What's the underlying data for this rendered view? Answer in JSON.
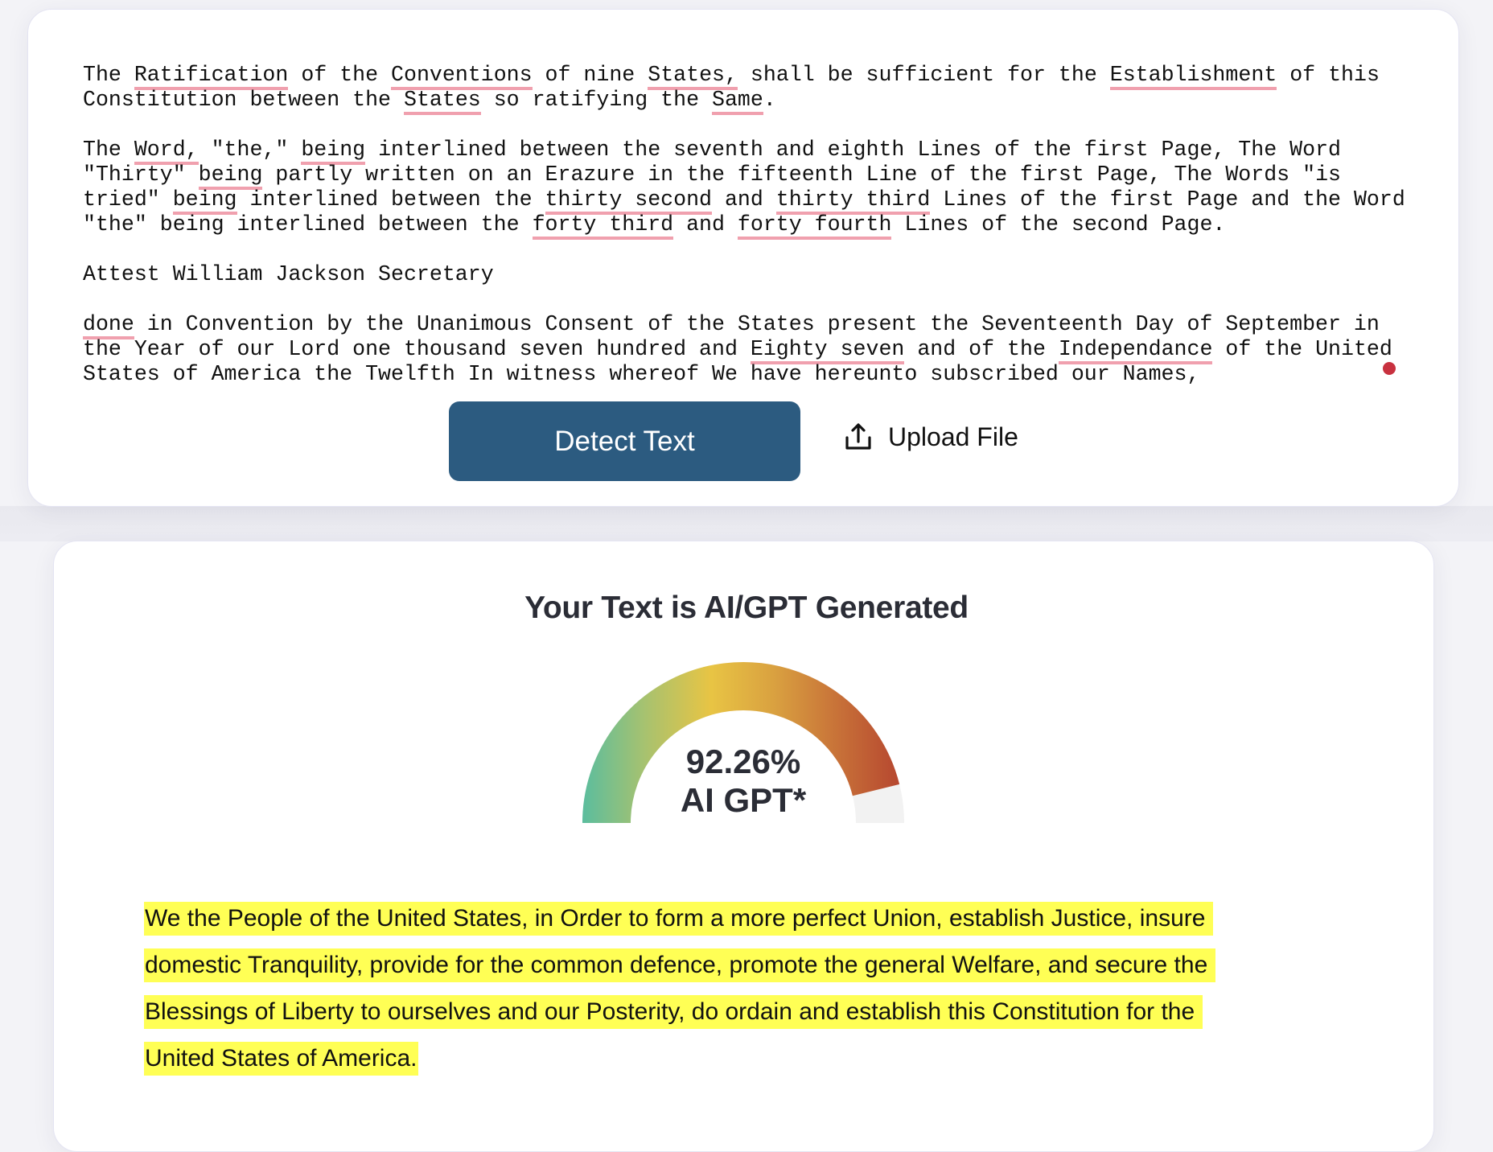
{
  "editor": {
    "lines": [
      [
        {
          "t": "The "
        },
        {
          "t": "Ratification",
          "f": true
        },
        {
          "t": " of the "
        },
        {
          "t": "Conventions",
          "f": true
        },
        {
          "t": " of nine "
        },
        {
          "t": "States,",
          "f": true
        },
        {
          "t": " shall be sufficient for the "
        },
        {
          "t": "Establishment",
          "f": true
        },
        {
          "t": " of this"
        }
      ],
      [
        {
          "t": "Constitution between the "
        },
        {
          "t": "States",
          "f": true
        },
        {
          "t": " so ratifying the "
        },
        {
          "t": "Same",
          "f": true
        },
        {
          "t": "."
        }
      ],
      [],
      [
        {
          "t": "The "
        },
        {
          "t": "Word,",
          "f": true
        },
        {
          "t": " \"the,\" "
        },
        {
          "t": "being",
          "f": true
        },
        {
          "t": " interlined between the seventh and eighth Lines of the first Page, The Word"
        }
      ],
      [
        {
          "t": "\"Thirty\" "
        },
        {
          "t": "being",
          "f": true
        },
        {
          "t": " partly written on an Erazure in the fifteenth Line of the first Page, The Words \"is"
        }
      ],
      [
        {
          "t": "tried\" "
        },
        {
          "t": "being",
          "f": true
        },
        {
          "t": " interlined between the "
        },
        {
          "t": "thirty second",
          "f": true
        },
        {
          "t": " and "
        },
        {
          "t": "thirty third",
          "f": true
        },
        {
          "t": " Lines of the first Page and the Word"
        }
      ],
      [
        {
          "t": "\"the\" being interlined between the "
        },
        {
          "t": "forty third",
          "f": true
        },
        {
          "t": " and "
        },
        {
          "t": "forty fourth",
          "f": true
        },
        {
          "t": " Lines of the second Page."
        }
      ],
      [],
      [
        {
          "t": "Attest William Jackson Secretary"
        }
      ],
      [],
      [
        {
          "t": "done",
          "f": true
        },
        {
          "t": " in Convention by the Unanimous Consent of the States present the Seventeenth Day of September in"
        }
      ],
      [
        {
          "t": "the Year of our Lord one thousand seven hundred and "
        },
        {
          "t": "Eighty seven",
          "f": true
        },
        {
          "t": " and of the "
        },
        {
          "t": "Independance",
          "f": true
        },
        {
          "t": " of the United"
        }
      ],
      [
        {
          "t": "States of America the Twelfth In witness whereof We have hereunto subscribed our Names,"
        }
      ]
    ]
  },
  "actions": {
    "detect_label": "Detect Text",
    "upload_label": "Upload File",
    "upload_icon": "upload-icon"
  },
  "result": {
    "title": "Your Text is AI/GPT Generated",
    "score_text": "92.26%",
    "score_label": "AI GPT*",
    "score_fraction": 0.9226,
    "gauge_colors": [
      "#5bbd9e",
      "#a9c26e",
      "#e8c444",
      "#d9a040",
      "#c77038",
      "#b5442f"
    ],
    "gauge_track_color": "#f2f2f2",
    "highlight_color": "#ffff55",
    "highlighted_lines": [
      "We the People of the United States, in Order to form a more perfect Union, establish Justice, insure ",
      "domestic Tranquility, provide for the common defence, promote the general Welfare, and secure the ",
      "Blessings of Liberty to ourselves and our Posterity, do ordain and establish this Constitution for the ",
      "United States of America."
    ]
  },
  "colors": {
    "primary_button": "#2c5b80",
    "flag_underline": "#f0a0ae",
    "cursor_dot": "#c8313f",
    "heading_text": "#2b2d36"
  }
}
